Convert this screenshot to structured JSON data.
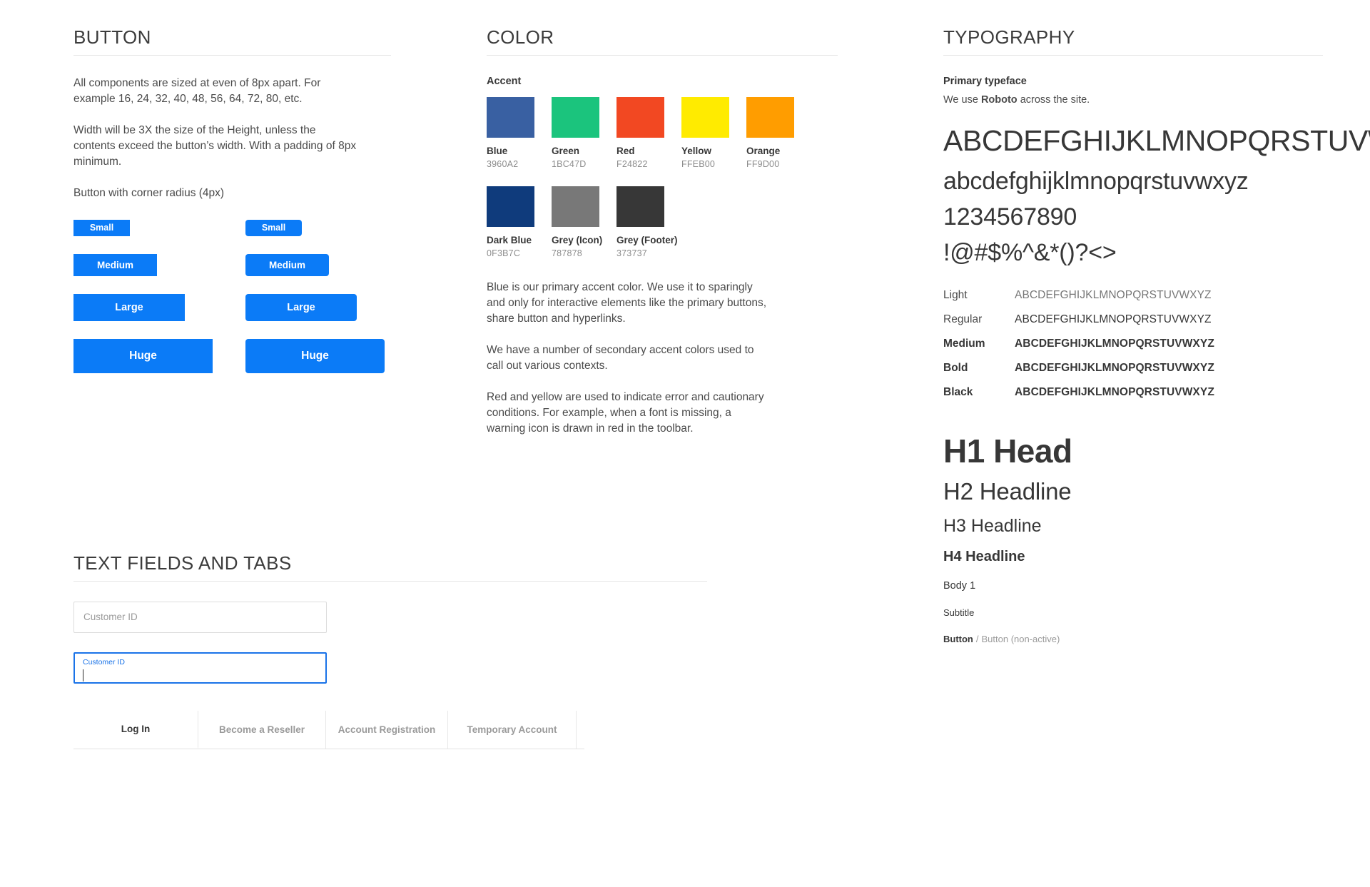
{
  "sections": {
    "button": {
      "title": "BUTTON",
      "paragraphs": [
        "All components are sized at even of 8px apart. For example 16, 24, 32, 40, 48, 56, 64, 72, 80, etc.",
        "Width will be 3X the size of the Height, unless the contents exceed the button’s width. With a padding of 8px minimum.",
        "Button with corner radius (4px)"
      ],
      "sizes": {
        "small": "Small",
        "medium": "Medium",
        "large": "Large",
        "huge": "Huge"
      },
      "button_color": "#0B7BF7"
    },
    "color": {
      "title": "COLOR",
      "group_label": "Accent",
      "swatches_row1": [
        {
          "name": "Blue",
          "hex": "3960A2",
          "css": "#3960A2"
        },
        {
          "name": "Green",
          "hex": "1BC47D",
          "css": "#1BC47D"
        },
        {
          "name": "Red",
          "hex": "F24822",
          "css": "#F24822"
        },
        {
          "name": "Yellow",
          "hex": "FFEB00",
          "css": "#FFEB00"
        },
        {
          "name": "Orange",
          "hex": "FF9D00",
          "css": "#FF9D00"
        }
      ],
      "swatches_row2": [
        {
          "name": "Dark Blue",
          "hex": "0F3B7C",
          "css": "#0F3B7C"
        },
        {
          "name": "Grey (Icon)",
          "hex": "787878",
          "css": "#787878"
        },
        {
          "name": "Grey (Footer)",
          "hex": "373737",
          "css": "#373737"
        }
      ],
      "paragraphs": [
        "Blue is our primary accent color. We use it to sparingly and only for interactive elements like the primary buttons, share button and hyperlinks.",
        "We have a number of secondary accent colors used to call out various contexts.",
        "Red and yellow are used to indicate error and cautionary conditions. For example, when a font is missing, a warning icon is drawn in red in the toolbar."
      ]
    },
    "typography": {
      "title": "TYPOGRAPHY",
      "primary_label": "Primary typeface",
      "primary_note_prefix": "We use ",
      "primary_note_font": "Roboto",
      "primary_note_suffix": " across the site.",
      "glyphs_upper": "ABCDEFGHIJKLMNOPQRSTUVWXYZ",
      "glyphs_lower": "abcdefghijklmnopqrstuvwxyz",
      "glyphs_digits": "1234567890",
      "glyphs_symbols": "!@#$%^&*()?<>",
      "weights": [
        {
          "name": "Light",
          "sample": "ABCDEFGHIJKLMNOPQRSTUVWXYZ"
        },
        {
          "name": "Regular",
          "sample": "ABCDEFGHIJKLMNOPQRSTUVWXYZ"
        },
        {
          "name": "Medium",
          "sample": "ABCDEFGHIJKLMNOPQRSTUVWXYZ"
        },
        {
          "name": "Bold",
          "sample": "ABCDEFGHIJKLMNOPQRSTUVWXYZ"
        },
        {
          "name": "Black",
          "sample": "ABCDEFGHIJKLMNOPQRSTUVWXYZ"
        }
      ],
      "scale": {
        "h1": "H1 Head",
        "h2": "H2 Headline",
        "h3": "H3 Headline",
        "h4": "H4 Headline",
        "body1": "Body 1",
        "subtitle": "Subtitle",
        "button_active": "Button",
        "button_separator": "/",
        "button_inactive": "Button (non-active)"
      }
    },
    "fields": {
      "title": "TEXT FIELDS AND TABS",
      "input_placeholder": "Customer ID",
      "focused_input_label": "Customer ID",
      "focused_input_value": "",
      "tabs": [
        {
          "label": "Log In",
          "active": true
        },
        {
          "label": "Become a Reseller",
          "active": false
        },
        {
          "label": "Account Registration",
          "active": false
        },
        {
          "label": "Temporary Account",
          "active": false
        }
      ]
    }
  }
}
